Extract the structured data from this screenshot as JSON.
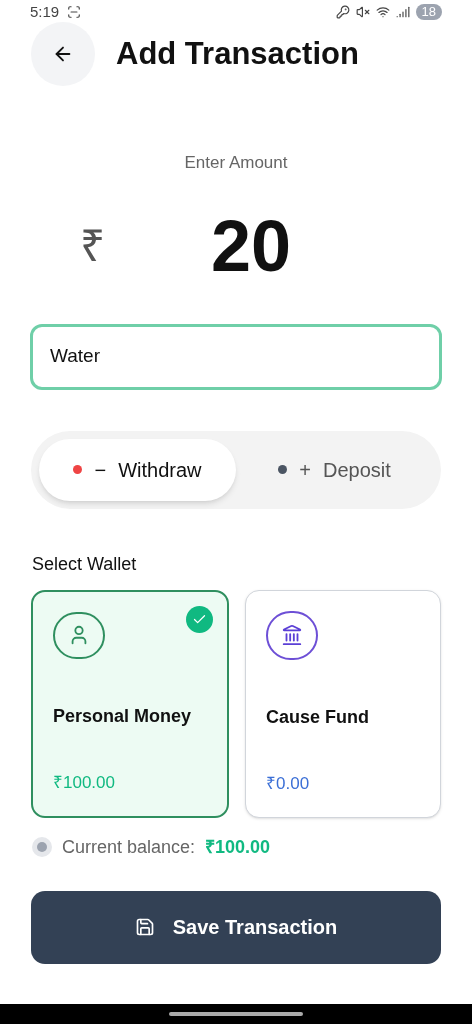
{
  "status_bar": {
    "time": "5:19",
    "battery": "18"
  },
  "header": {
    "title": "Add Transaction"
  },
  "amount": {
    "label": "Enter Amount",
    "currency": "₹",
    "value": "20"
  },
  "note": {
    "value": "Water"
  },
  "type_toggle": [
    {
      "sign": "−",
      "label": "Withdraw",
      "color": "#ef4444",
      "selected": true
    },
    {
      "sign": "+",
      "label": "Deposit",
      "color": "#4b5563",
      "selected": false
    }
  ],
  "wallet_section": {
    "label": "Select Wallet"
  },
  "wallets": [
    {
      "kind": "person",
      "name": "Personal Money",
      "balance": "₹100.00",
      "color": "#10b981",
      "selected": true
    },
    {
      "kind": "bank",
      "name": "Cause Fund",
      "balance": "₹0.00",
      "color": "#3b6fd6",
      "selected": false
    }
  ],
  "current_balance": {
    "label": "Current balance:",
    "value": "₹100.00"
  },
  "save_button": {
    "label": "Save Transaction"
  }
}
